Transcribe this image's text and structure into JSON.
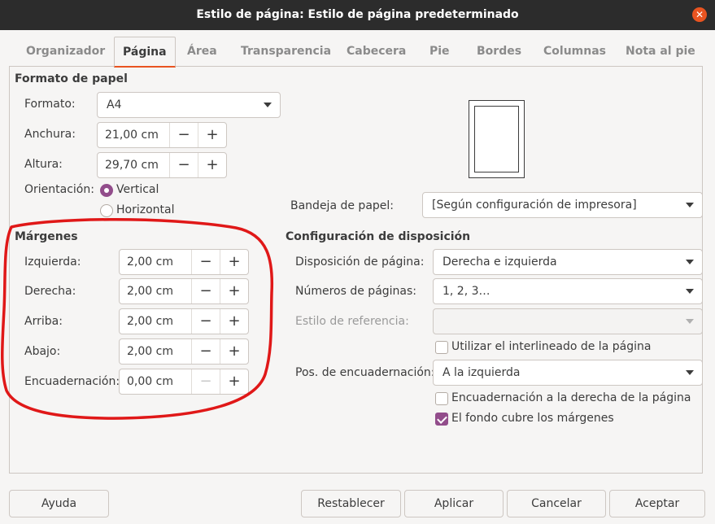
{
  "window": {
    "title": "Estilo de página: Estilo de página predeterminado",
    "close_symbol": "✕"
  },
  "tabs": [
    {
      "label": "Organizador"
    },
    {
      "label": "Página"
    },
    {
      "label": "Área"
    },
    {
      "label": "Transparencia"
    },
    {
      "label": "Cabecera"
    },
    {
      "label": "Pie"
    },
    {
      "label": "Bordes"
    },
    {
      "label": "Columnas"
    },
    {
      "label": "Nota al pie"
    }
  ],
  "paper_format": {
    "title": "Formato de papel",
    "format_label": "Formato:",
    "format_value": "A4",
    "width_label": "Anchura:",
    "width_value": "21,00 cm",
    "height_label": "Altura:",
    "height_value": "29,70 cm",
    "orientation_label": "Orientación:",
    "vertical_label": "Vertical",
    "horizontal_label": "Horizontal",
    "orientation_selected": "Vertical"
  },
  "margins": {
    "title": "Márgenes",
    "left_label": "Izquierda:",
    "left_value": "2,00 cm",
    "right_label": "Derecha:",
    "right_value": "2,00 cm",
    "top_label": "Arriba:",
    "top_value": "2,00 cm",
    "bottom_label": "Abajo:",
    "bottom_value": "2,00 cm",
    "gutter_label": "Encuadernación:",
    "gutter_value": "0,00 cm"
  },
  "tray": {
    "label": "Bandeja de papel:",
    "value": "[Según configuración de impresora]"
  },
  "layout": {
    "title": "Configuración de disposición",
    "page_layout_label": "Disposición de página:",
    "page_layout_value": "Derecha e izquierda",
    "page_numbers_label": "Números de páginas:",
    "page_numbers_value": "1, 2, 3…",
    "reference_style_label": "Estilo de referencia:",
    "reference_style_value": "",
    "use_line_spacing_label": "Utilizar el interlineado de la página",
    "use_line_spacing_checked": false,
    "gutter_position_label": "Pos. de encuadernación:",
    "gutter_position_value": "A la izquierda",
    "gutter_right_label": "Encuadernación a la derecha de la página",
    "gutter_right_checked": false,
    "background_covers_label": "El fondo cubre los márgenes",
    "background_covers_checked": true
  },
  "spin": {
    "minus": "−",
    "plus": "+"
  },
  "buttons": {
    "help": "Ayuda",
    "reset": "Restablecer",
    "apply": "Aplicar",
    "cancel": "Cancelar",
    "ok": "Aceptar"
  },
  "colors": {
    "accent": "#e95420",
    "checkbox": "#924d8b",
    "annotation": "#e01818"
  }
}
